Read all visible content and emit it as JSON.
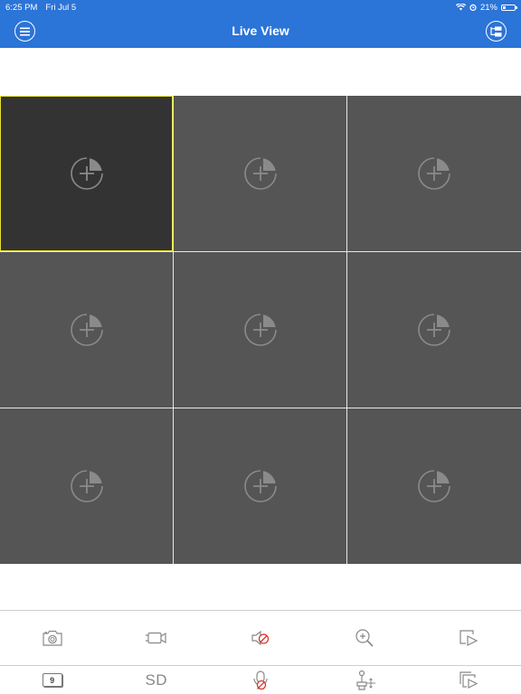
{
  "status": {
    "time": "6:25 PM",
    "date": "Fri Jul 5",
    "battery_percent": "21%",
    "battery_level": 0.21
  },
  "nav": {
    "title": "Live View",
    "menu_icon": "menu-icon",
    "device_list_icon": "device-list-icon"
  },
  "grid": {
    "cells": [
      {
        "selected": true,
        "icon": "add-camera-icon"
      },
      {
        "selected": false,
        "icon": "add-camera-icon"
      },
      {
        "selected": false,
        "icon": "add-camera-icon"
      },
      {
        "selected": false,
        "icon": "add-camera-icon"
      },
      {
        "selected": false,
        "icon": "add-camera-icon"
      },
      {
        "selected": false,
        "icon": "add-camera-icon"
      },
      {
        "selected": false,
        "icon": "add-camera-icon"
      },
      {
        "selected": false,
        "icon": "add-camera-icon"
      },
      {
        "selected": false,
        "icon": "add-camera-icon"
      }
    ]
  },
  "toolbar_top": [
    "snapshot-icon",
    "record-icon",
    "audio-muted-icon",
    "zoom-icon",
    "playback-icon"
  ],
  "toolbar_bottom": {
    "split_count": "9",
    "stream_quality": "SD",
    "icons": [
      "split-screen-icon",
      "stream-quality-label",
      "talk-disabled-icon",
      "ptz-icon",
      "multi-playback-icon"
    ]
  },
  "colors": {
    "accent": "#2b74d8",
    "cell": "#555555",
    "selected_cell": "#333333",
    "selected_border": "#e6e233",
    "muted_red": "#d9342b"
  }
}
